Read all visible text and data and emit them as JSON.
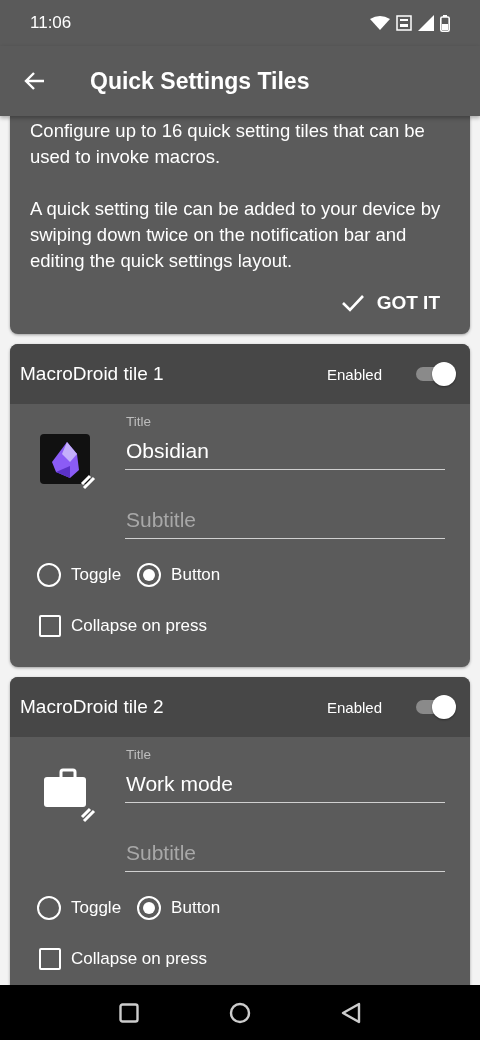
{
  "status_bar": {
    "time": "11:06"
  },
  "app_bar": {
    "title": "Quick Settings Tiles"
  },
  "info_card": {
    "paragraphs": [
      "Configure up to 16 quick setting tiles that can be used to invoke macros.",
      "A quick setting tile can be added to your device by swiping down twice on the notification bar and editing the quick settings layout."
    ],
    "button": "GOT IT"
  },
  "tiles": [
    {
      "name": "MacroDroid tile 1",
      "enabled_label": "Enabled",
      "enabled": true,
      "icon": {
        "kind": "crystal"
      },
      "title_label": "Title",
      "title": "Obsidian",
      "subtitle_placeholder": "Subtitle",
      "modes": [
        {
          "label": "Toggle",
          "selected": false
        },
        {
          "label": "Button",
          "selected": true
        }
      ],
      "collapse": {
        "label": "Collapse on press",
        "checked": false
      }
    },
    {
      "name": "MacroDroid tile 2",
      "enabled_label": "Enabled",
      "enabled": true,
      "icon": {
        "kind": "briefcase"
      },
      "title_label": "Title",
      "title": "Work mode",
      "subtitle_placeholder": "Subtitle",
      "modes": [
        {
          "label": "Toggle",
          "selected": false
        },
        {
          "label": "Button",
          "selected": true
        }
      ],
      "collapse": {
        "label": "Collapse on press",
        "checked": false
      }
    }
  ]
}
